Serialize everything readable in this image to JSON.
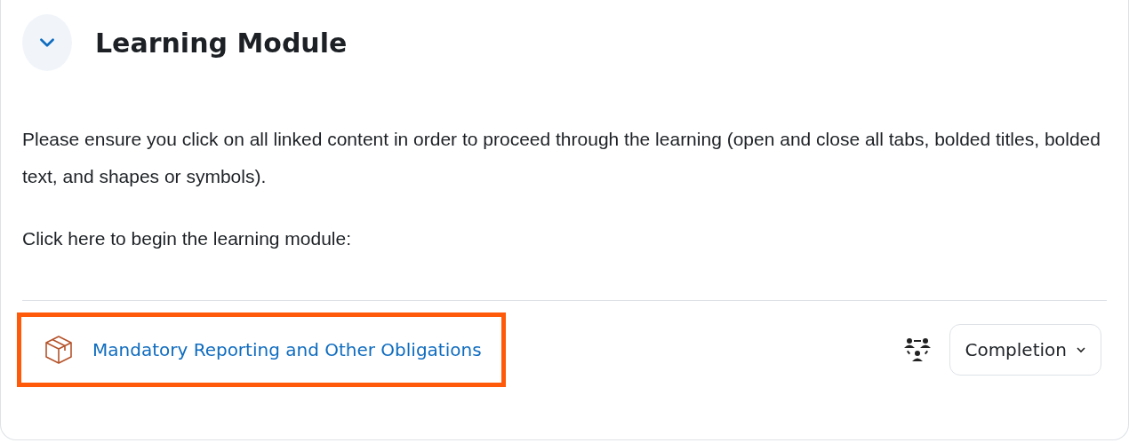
{
  "section": {
    "title": "Learning Module",
    "expanded": true
  },
  "paragraphs": [
    "Please ensure you click on all linked content in order to proceed through the learning (open and close all tabs, bolded titles, bolded text, and shapes or symbols).",
    "Click here to begin the learning module:"
  ],
  "activity": {
    "title": "Mandatory Reporting and Other Obligations",
    "highlighted": true,
    "completion_button": "Completion"
  }
}
